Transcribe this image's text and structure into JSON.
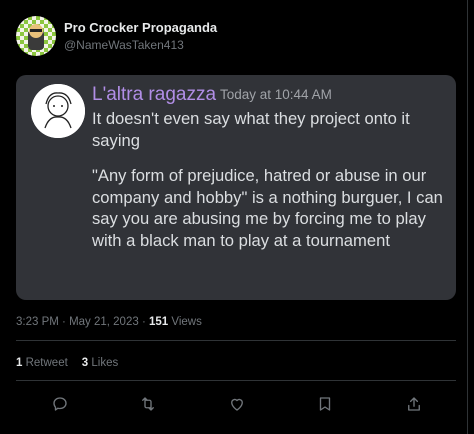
{
  "tweet": {
    "author_name": "Pro Crocker Propaganda",
    "author_handle": "@NameWasTaken413",
    "time": "3:23 PM",
    "date": "May 21, 2023",
    "views_count": "151",
    "views_label": "Views",
    "retweets_count": "1",
    "retweets_label": "Retweet",
    "likes_count": "3",
    "likes_label": "Likes"
  },
  "embedded_message": {
    "author": "L'altra ragazza",
    "timestamp": "Today at 10:44 AM",
    "paragraph1": "It doesn't even say what they project onto it saying",
    "paragraph2": "\"Any form of prejudice, hatred or abuse in our company and hobby\" is a nothing burguer, I can say you are abusing me by forcing me to play with a black man to play at a tournament"
  },
  "actions": [
    "reply-icon",
    "retweet-icon",
    "like-icon",
    "bookmark-icon",
    "share-icon"
  ],
  "colors": {
    "background": "#000000",
    "card": "#313338",
    "username": "#b18ee6",
    "muted": "#71767b"
  }
}
